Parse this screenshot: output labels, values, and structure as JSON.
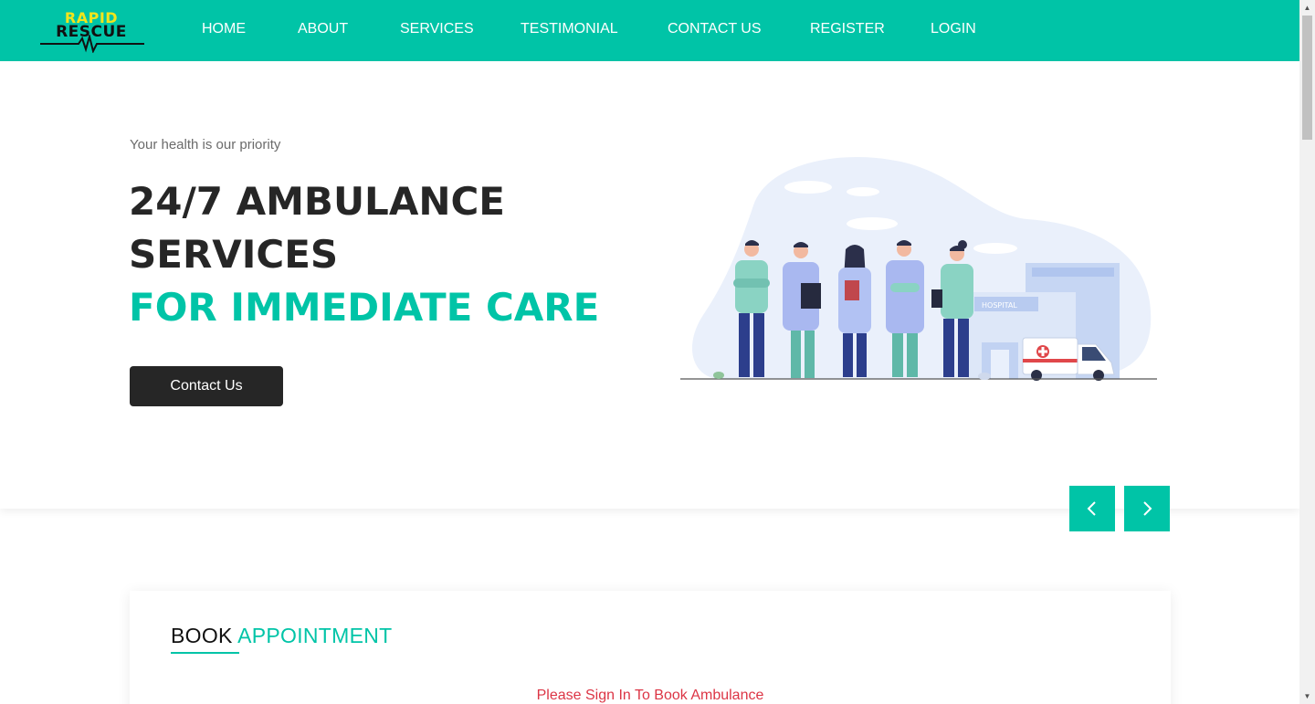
{
  "brand": {
    "line1": "RAPID",
    "line2": "RESCUE"
  },
  "nav": {
    "items": [
      {
        "label": "HOME"
      },
      {
        "label": "ABOUT"
      },
      {
        "label": "SERVICES"
      },
      {
        "label": "TESTIMONIAL"
      },
      {
        "label": "CONTACT US"
      },
      {
        "label": "REGISTER"
      },
      {
        "label": "LOGIN"
      }
    ]
  },
  "hero": {
    "tagline": "Your health is our priority",
    "headline_line1": "24/7 AMBULANCE",
    "headline_line2": "SERVICES",
    "headline_line3": "FOR IMMEDIATE CARE",
    "cta_label": "Contact Us",
    "illustration": {
      "sign_text": "HOSPITAL"
    }
  },
  "carousel": {
    "prev_icon": "chevron-left-icon",
    "next_icon": "chevron-right-icon"
  },
  "booking": {
    "title_part1": "BOOK",
    "title_part2": "APPOINTMENT",
    "message": "Please Sign In To Book Ambulance"
  },
  "colors": {
    "accent": "#00c4a7",
    "brand_yellow": "#f2e51c",
    "dark": "#262626",
    "error": "#dc3545"
  }
}
